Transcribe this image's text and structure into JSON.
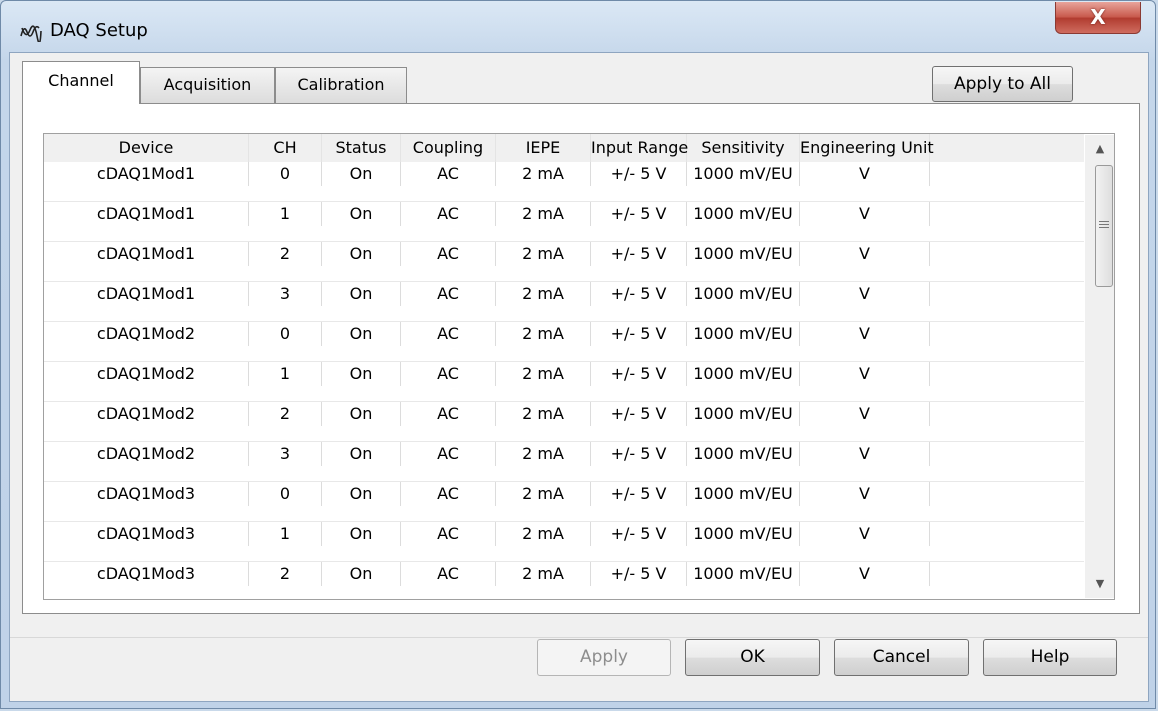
{
  "window": {
    "title": "DAQ Setup",
    "close_label": "X"
  },
  "tabs": [
    {
      "label": "Channel"
    },
    {
      "label": "Acquisition"
    },
    {
      "label": "Calibration"
    }
  ],
  "apply_to_all_label": "Apply to All",
  "table": {
    "columns": [
      "Device",
      "CH",
      "Status",
      "Coupling",
      "IEPE",
      "Input Range",
      "Sensitivity",
      "Engineering Unit"
    ],
    "rows": [
      [
        "cDAQ1Mod1",
        "0",
        "On",
        "AC",
        "2 mA",
        "+/- 5 V",
        "1000 mV/EU",
        "V"
      ],
      [
        "cDAQ1Mod1",
        "1",
        "On",
        "AC",
        "2 mA",
        "+/- 5 V",
        "1000 mV/EU",
        "V"
      ],
      [
        "cDAQ1Mod1",
        "2",
        "On",
        "AC",
        "2 mA",
        "+/- 5 V",
        "1000 mV/EU",
        "V"
      ],
      [
        "cDAQ1Mod1",
        "3",
        "On",
        "AC",
        "2 mA",
        "+/- 5 V",
        "1000 mV/EU",
        "V"
      ],
      [
        "cDAQ1Mod2",
        "0",
        "On",
        "AC",
        "2 mA",
        "+/- 5 V",
        "1000 mV/EU",
        "V"
      ],
      [
        "cDAQ1Mod2",
        "1",
        "On",
        "AC",
        "2 mA",
        "+/- 5 V",
        "1000 mV/EU",
        "V"
      ],
      [
        "cDAQ1Mod2",
        "2",
        "On",
        "AC",
        "2 mA",
        "+/- 5 V",
        "1000 mV/EU",
        "V"
      ],
      [
        "cDAQ1Mod2",
        "3",
        "On",
        "AC",
        "2 mA",
        "+/- 5 V",
        "1000 mV/EU",
        "V"
      ],
      [
        "cDAQ1Mod3",
        "0",
        "On",
        "AC",
        "2 mA",
        "+/- 5 V",
        "1000 mV/EU",
        "V"
      ],
      [
        "cDAQ1Mod3",
        "1",
        "On",
        "AC",
        "2 mA",
        "+/- 5 V",
        "1000 mV/EU",
        "V"
      ],
      [
        "cDAQ1Mod3",
        "2",
        "On",
        "AC",
        "2 mA",
        "+/- 5 V",
        "1000 mV/EU",
        "V"
      ]
    ]
  },
  "footer": {
    "apply_label": "Apply",
    "ok_label": "OK",
    "cancel_label": "Cancel",
    "help_label": "Help"
  }
}
